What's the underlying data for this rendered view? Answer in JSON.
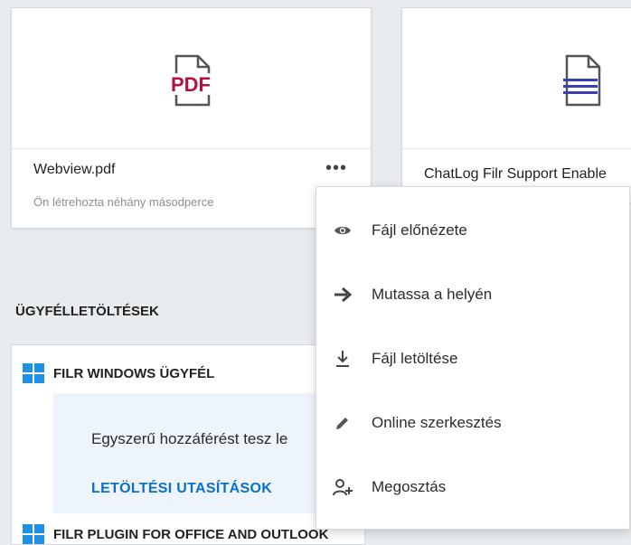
{
  "files": [
    {
      "name": "Webview.pdf",
      "subtitle": "Ön létrehozta néhány másodperce",
      "type_label": "PDF",
      "more": "•••"
    },
    {
      "name": "ChatLog Filr Support Enable"
    }
  ],
  "section": {
    "title": "ÜGYFÉLLETÖLTÉSEK"
  },
  "downloads": {
    "windows": {
      "title": "FILR WINDOWS ÜGYFÉL",
      "description": "Egyszerű hozzáférést tesz le",
      "link": "LETÖLTÉSI UTASÍTÁSOK"
    },
    "office": {
      "title": "FILR PLUGIN FOR OFFICE AND OUTLOOK"
    }
  },
  "context_menu": {
    "items": [
      {
        "label": "Fájl előnézete",
        "icon": "eye-icon"
      },
      {
        "label": "Mutassa a helyén",
        "icon": "arrow-right-icon"
      },
      {
        "label": "Fájl letöltése",
        "icon": "download-icon"
      },
      {
        "label": "Online szerkesztés",
        "icon": "pencil-icon"
      },
      {
        "label": "Megosztás",
        "icon": "share-user-icon"
      }
    ]
  },
  "colors": {
    "pdf": "#b5123e",
    "doc_lines": "#3b3fb6",
    "link": "#0a6fc7",
    "windows": "#1e90e6"
  }
}
